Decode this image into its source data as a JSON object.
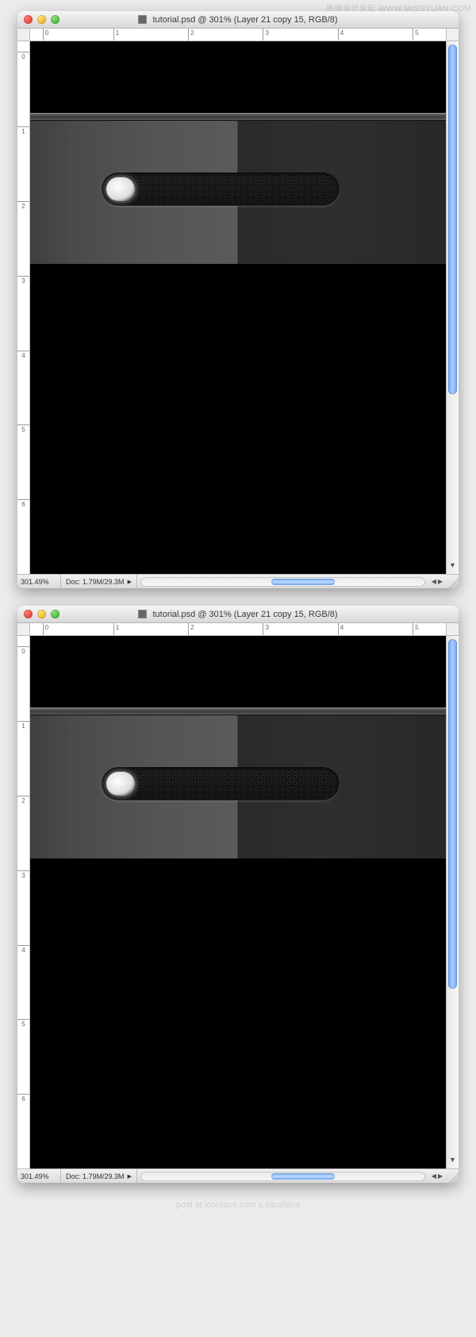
{
  "watermark_top": "思缘设计论坛  WWW.MISSYUAN.COM",
  "watermark_bottom": "post at iconfans.com x.sarailans",
  "window": {
    "title": "tutorial.psd @ 301% (Layer 21 copy 15, RGB/8)"
  },
  "ruler_h": {
    "marks": [
      "0",
      "1",
      "2",
      "3",
      "4",
      "5"
    ]
  },
  "ruler_v": {
    "marks": [
      "0",
      "1",
      "2",
      "3",
      "4",
      "5",
      "6"
    ]
  },
  "status": {
    "zoom": "301.49%",
    "doc_label": "Doc:",
    "doc_size": "1.79M/29.3M"
  }
}
